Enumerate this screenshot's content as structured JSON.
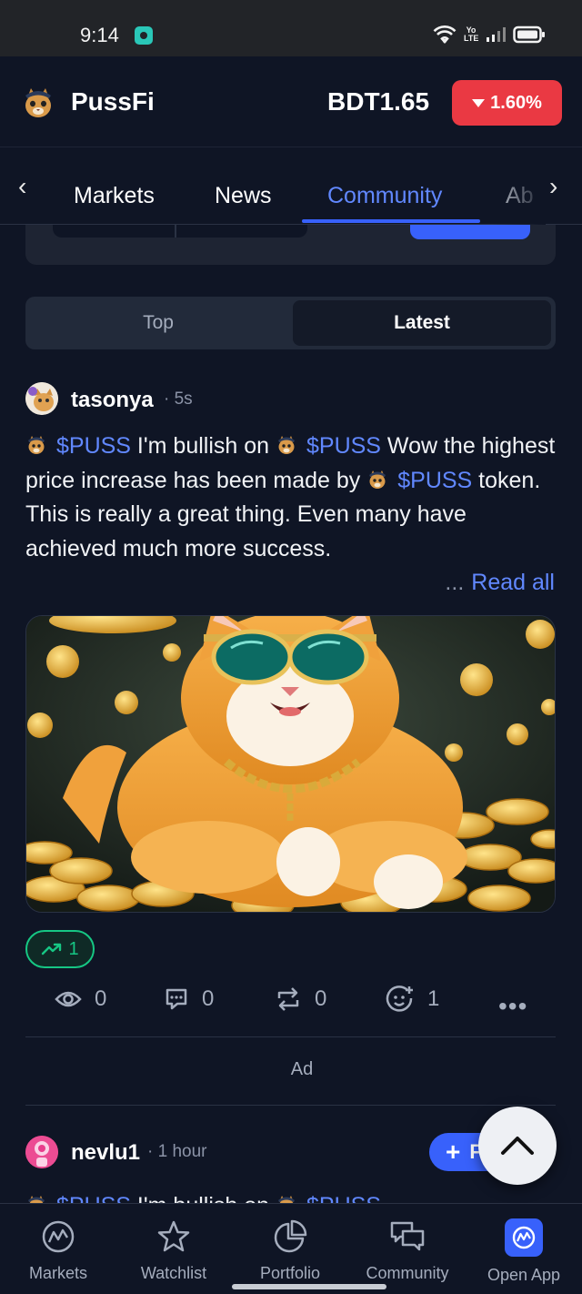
{
  "status_bar": {
    "time": "9:14",
    "network": "Yo LTE"
  },
  "header": {
    "coin_name": "PussFi",
    "price": "BDT1.65",
    "change": "1.60%",
    "change_color": "#ea3943"
  },
  "tabs": [
    {
      "label": "Markets"
    },
    {
      "label": "News"
    },
    {
      "label": "Community"
    },
    {
      "label": "Ab"
    }
  ],
  "feed_toggle": {
    "top": "Top",
    "latest": "Latest"
  },
  "post1": {
    "username": "tasonya",
    "time": "5s",
    "segments": {
      "tag1": "$PUSS",
      "text1": " I'm bullish on ",
      "tag2": "$PUSS",
      "text2": " Wow the highest price increase has been made by ",
      "tag3": "$PUSS",
      "text3": " token. This is really a great thing. Even many have achieved much more success."
    },
    "read_all": "Read all",
    "ellipsis": "...",
    "trend_count": "1",
    "stats": {
      "views": "0",
      "comments": "0",
      "reposts": "0",
      "reactions": "1"
    }
  },
  "ad_label": "Ad",
  "post2": {
    "username": "nevlu1",
    "time": "1 hour",
    "follow_label": "Follow",
    "tag1": "$PUSS",
    "text1": " I'm bullish on ",
    "tag2": "$PUSS"
  },
  "bottom_nav": [
    {
      "label": "Markets"
    },
    {
      "label": "Watchlist"
    },
    {
      "label": "Portfolio"
    },
    {
      "label": "Community"
    },
    {
      "label": "Open App"
    }
  ],
  "colors": {
    "accent": "#3861fb",
    "link": "#6188ff",
    "positive": "#16c784",
    "negative": "#ea3943",
    "background": "#0f1525"
  }
}
